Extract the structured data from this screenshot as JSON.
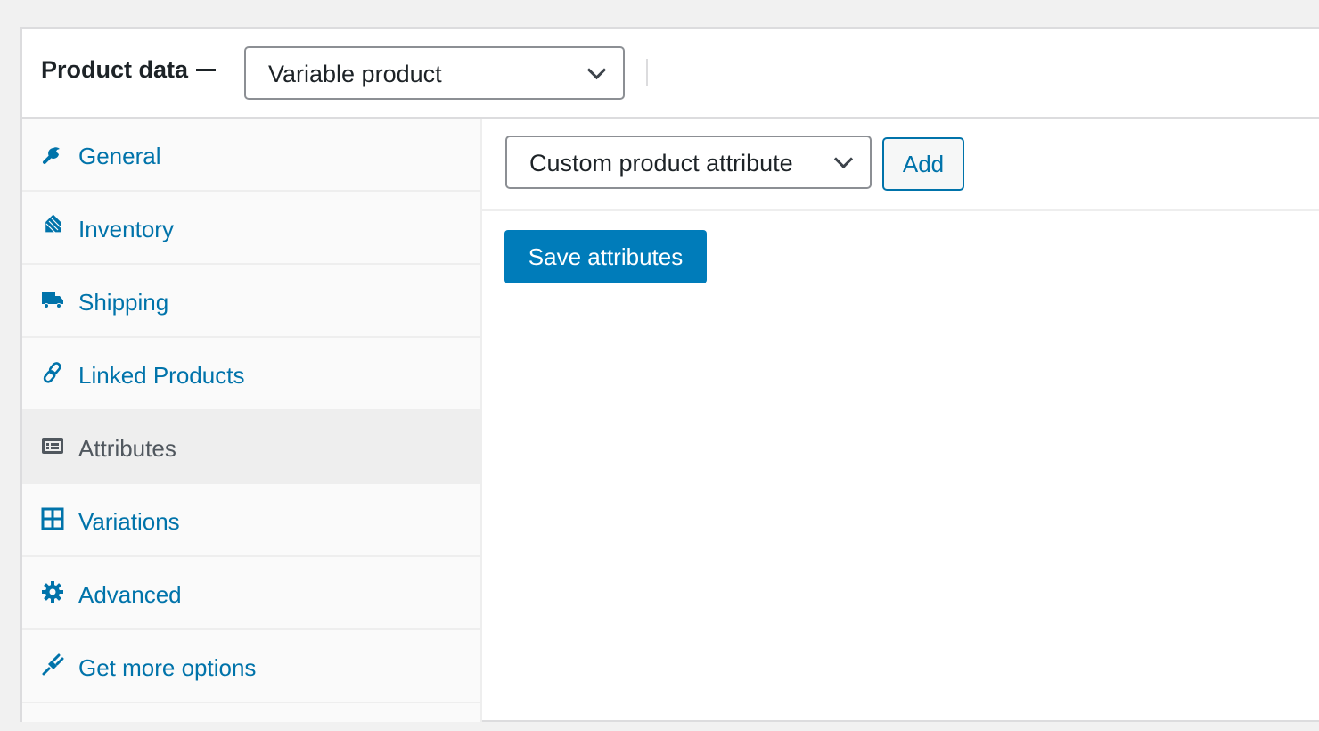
{
  "header": {
    "title": "Product data",
    "product_type": {
      "selected": "Variable product"
    }
  },
  "sidebar": {
    "items": [
      {
        "label": "General",
        "icon": "wrench-icon",
        "active": false
      },
      {
        "label": "Inventory",
        "icon": "tag-icon",
        "active": false
      },
      {
        "label": "Shipping",
        "icon": "truck-icon",
        "active": false
      },
      {
        "label": "Linked Products",
        "icon": "link-icon",
        "active": false
      },
      {
        "label": "Attributes",
        "icon": "list-card-icon",
        "active": true
      },
      {
        "label": "Variations",
        "icon": "grid-icon",
        "active": false
      },
      {
        "label": "Advanced",
        "icon": "gear-icon",
        "active": false
      },
      {
        "label": "Get more options",
        "icon": "plugin-icon",
        "active": false
      }
    ]
  },
  "content": {
    "attribute_select": {
      "selected": "Custom product attribute"
    },
    "add_label": "Add",
    "save_label": "Save attributes"
  },
  "colors": {
    "link": "#0073aa",
    "primary_button": "#007cba",
    "active_tab_bg": "#eeeeee",
    "active_tab_text": "#50575e"
  }
}
